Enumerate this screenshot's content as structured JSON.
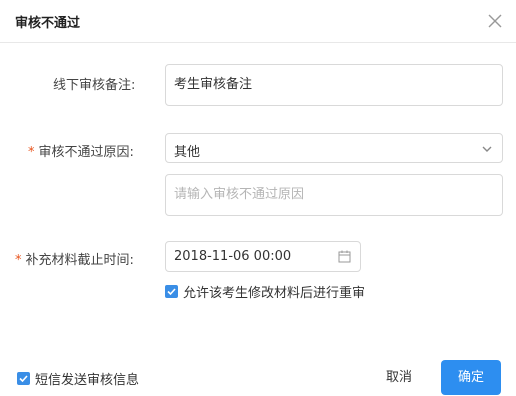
{
  "dialog": {
    "title": "审核不通过",
    "close_icon": "close-icon"
  },
  "form": {
    "offline_note": {
      "label": "线下审核备注:",
      "value": "考生审核备注"
    },
    "reject_reason": {
      "required_mark": "*",
      "label": "审核不通过原因:",
      "selected": "其他",
      "detail_placeholder": "请输入审核不通过原因"
    },
    "deadline": {
      "required_mark": "*",
      "label": "补充材料截止时间:",
      "value": "2018-11-06 00:00",
      "allow_resubmit": {
        "checked": true,
        "label": "允许该考生修改材料后进行重审"
      }
    }
  },
  "footer": {
    "sms_notify": {
      "checked": true,
      "label": "短信发送审核信息"
    },
    "cancel_label": "取消",
    "ok_label": "确定"
  },
  "colors": {
    "primary": "#2d8ef0",
    "required": "#e8541e",
    "border": "#d9d9d9",
    "placeholder": "#b5b5b5"
  }
}
